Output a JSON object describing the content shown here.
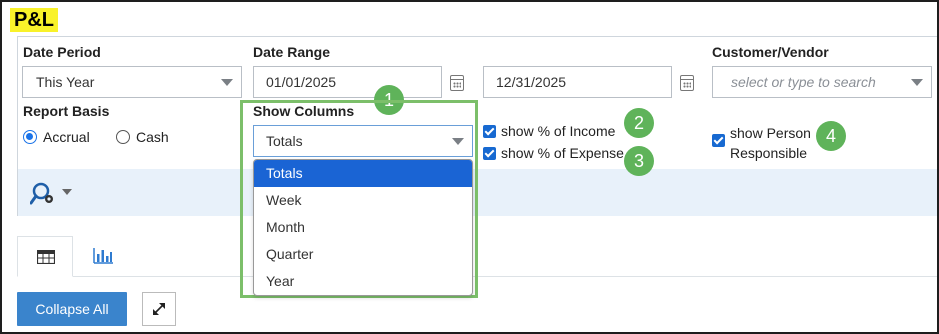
{
  "page": {
    "title": "P&L"
  },
  "filters": {
    "date_period": {
      "label": "Date Period",
      "value": "This Year"
    },
    "date_range": {
      "label": "Date Range",
      "start": "01/01/2025",
      "end": "12/31/2025"
    },
    "customer_vendor": {
      "label": "Customer/Vendor",
      "placeholder": "select or type to search"
    },
    "report_basis": {
      "label": "Report Basis",
      "options": [
        "Accrual",
        "Cash"
      ],
      "selected": "Accrual"
    },
    "show_columns": {
      "label": "Show Columns",
      "value": "Totals",
      "options": [
        "Totals",
        "Week",
        "Month",
        "Quarter",
        "Year"
      ]
    },
    "checkboxes": {
      "pct_income": "show % of Income",
      "pct_expense": "show % of Expense",
      "person_line1": "show Person",
      "person_line2": "Responsible"
    }
  },
  "callouts": [
    "1",
    "2",
    "3",
    "4"
  ],
  "icons": {
    "search_settings": "search-gear-icon",
    "table": "table-icon",
    "chart": "bar-chart-icon",
    "expand": "expand-icon"
  },
  "actions": {
    "collapse_all": "Collapse All"
  },
  "colors": {
    "highlight": "#f9f22a",
    "accent": "#1a64d4",
    "callout": "#5fb35a",
    "button": "#3a84cc"
  }
}
